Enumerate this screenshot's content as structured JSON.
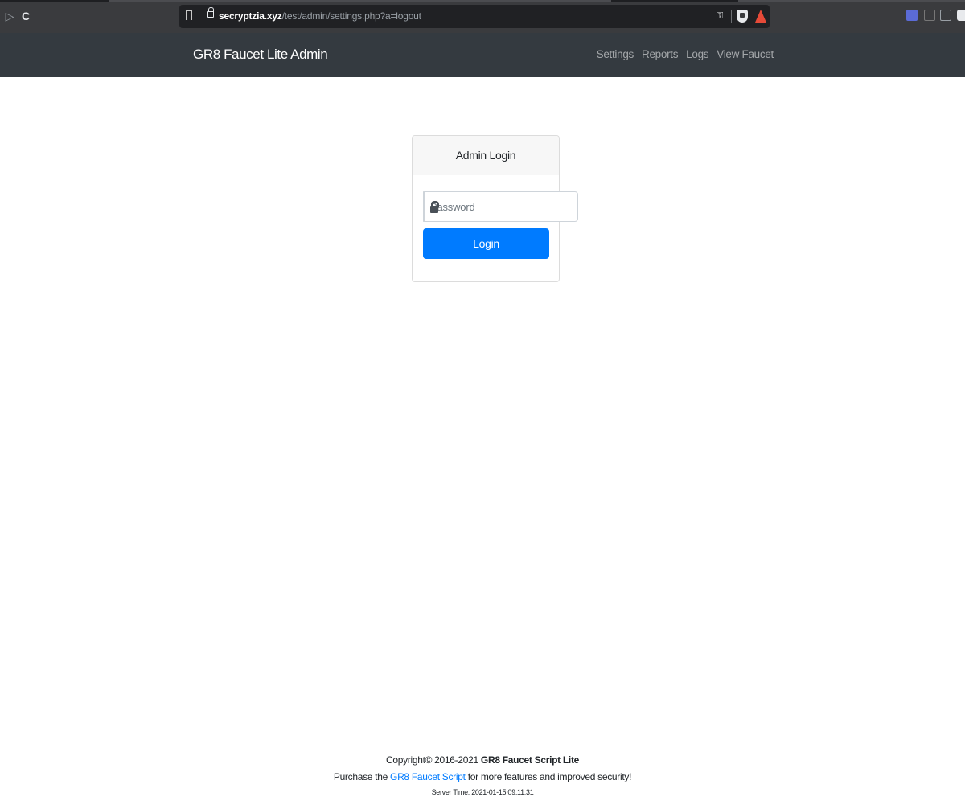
{
  "browser": {
    "url_host": "secryptzia.xyz",
    "url_path": "/test/admin/settings.php?a=logout"
  },
  "navbar": {
    "brand": "GR8 Faucet Lite Admin",
    "links": [
      {
        "label": "Settings"
      },
      {
        "label": "Reports"
      },
      {
        "label": "Logs"
      },
      {
        "label": "View Faucet"
      }
    ]
  },
  "login": {
    "title": "Admin Login",
    "password_placeholder": "Password",
    "button_label": "Login"
  },
  "footer": {
    "copyright_prefix": "Copyright© 2016-2021",
    "product_name": "GR8 Faucet Script Lite",
    "purchase_prefix": "Purchase the",
    "purchase_link": "GR8 Faucet Script",
    "purchase_suffix": "for more features and improved security!",
    "server_time": "Server Time: 2021-01-15 09:11:31"
  },
  "colors": {
    "navbar_bg": "#343a40",
    "primary": "#007bff",
    "browser_bg": "#3a3b3e"
  }
}
